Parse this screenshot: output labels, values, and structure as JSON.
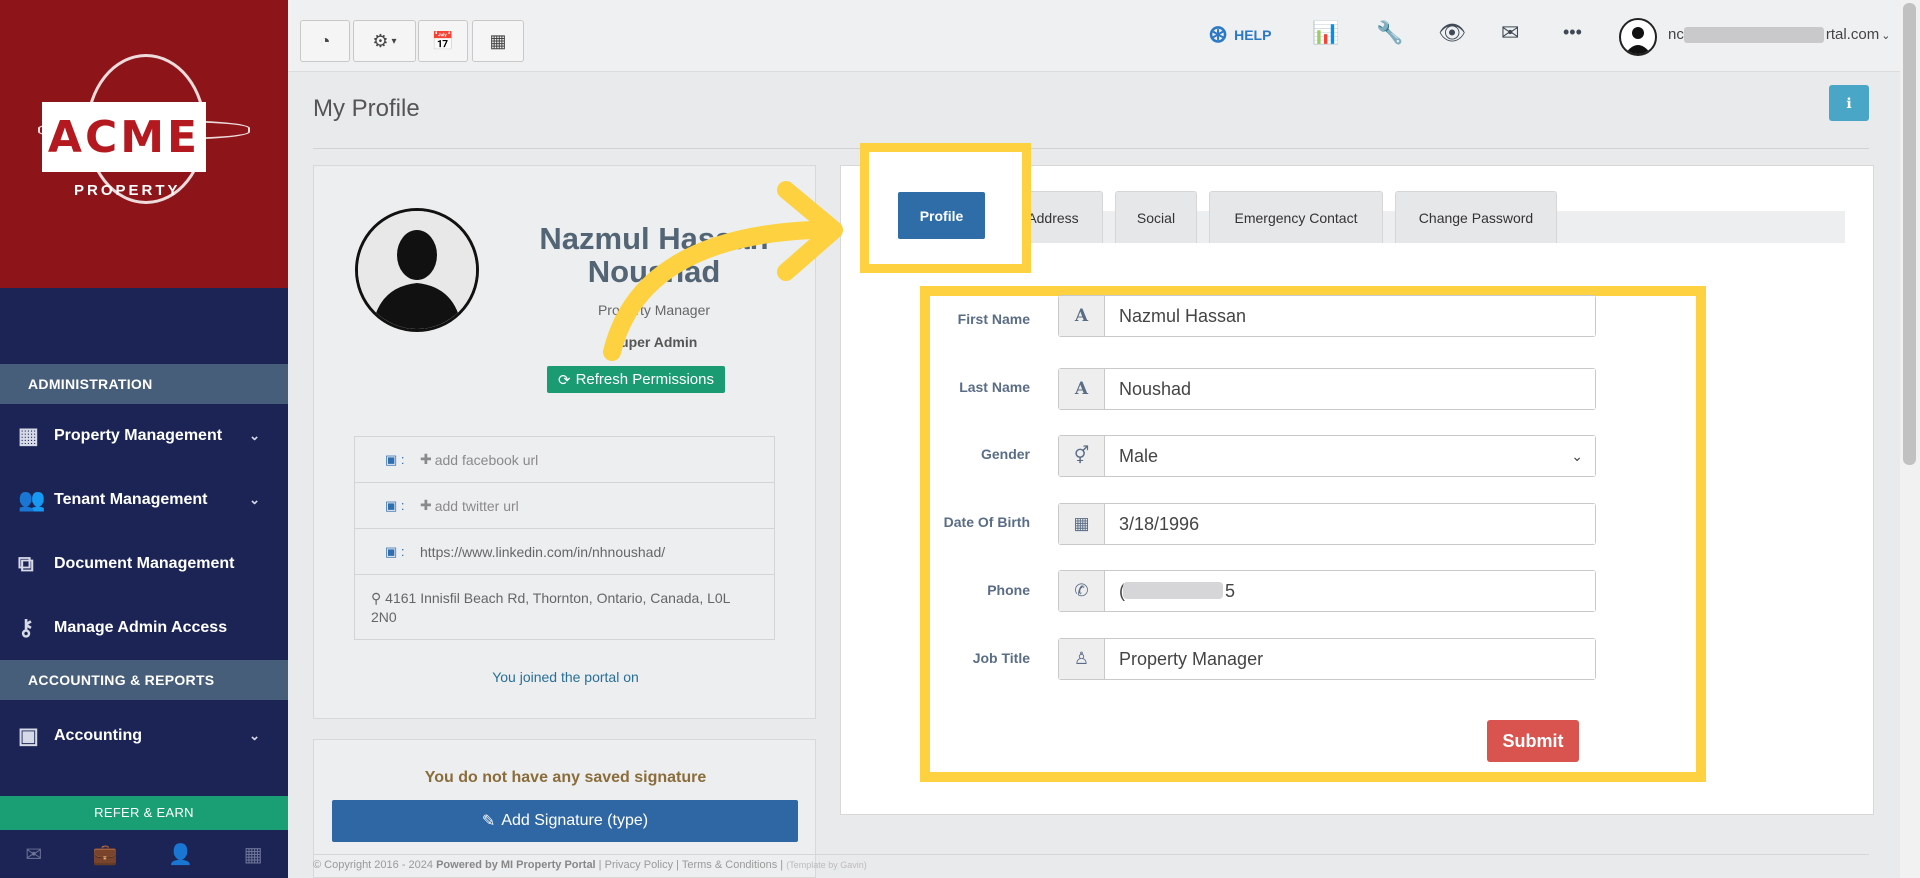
{
  "sidebar": {
    "logo_text": "ACME",
    "logo_sub": "PROPERTY",
    "section_admin": "ADMINISTRATION",
    "items_admin": [
      {
        "label": "Property Management",
        "icon": "building-icon",
        "chevron": true
      },
      {
        "label": "Tenant Management",
        "icon": "users-icon",
        "chevron": true
      },
      {
        "label": "Document Management",
        "icon": "documents-icon",
        "chevron": false
      },
      {
        "label": "Manage Admin Access",
        "icon": "key-icon",
        "chevron": false
      }
    ],
    "section_accounting": "ACCOUNTING & REPORTS",
    "items_accounting": [
      {
        "label": "Accounting",
        "icon": "money-icon",
        "chevron": true
      }
    ],
    "refer": "REFER & EARN"
  },
  "topbar": {
    "help": "HELP",
    "user_email_start": "nc",
    "user_email_end": "rtal.com"
  },
  "page": {
    "title": "My Profile"
  },
  "profile_card": {
    "name": "Nazmul Hassan Noushad",
    "role": "Property Manager",
    "access": "Super Admin",
    "refresh": "Refresh Permissions",
    "facebook": "add facebook url",
    "twitter": "add twitter url",
    "linkedin": "https://www.linkedin.com/in/nhnoushad/",
    "address": "4161 Innisfil Beach Rd, Thornton, Ontario, Canada, L0L 2N0",
    "joined": "You joined the portal on"
  },
  "signature": {
    "message": "You do not have any saved signature",
    "button": "Add Signature (type)"
  },
  "tabs": [
    "Profile",
    "Address",
    "Social",
    "Emergency Contact",
    "Change Password"
  ],
  "form": {
    "first_name_label": "First Name",
    "first_name": "Nazmul Hassan",
    "last_name_label": "Last Name",
    "last_name": "Noushad",
    "gender_label": "Gender",
    "gender": "Male",
    "dob_label": "Date Of Birth",
    "dob": "3/18/1996",
    "phone_label": "Phone",
    "phone_start": "(",
    "phone_end": "5",
    "job_title_label": "Job Title",
    "job_title": "Property Manager",
    "submit": "Submit"
  },
  "footer": {
    "copyright": "© Copyright 2016 - 2024",
    "powered": "Powered by MI Property Portal",
    "privacy": "Privacy Policy",
    "terms": "Terms & Conditions",
    "template": "(Template by Gavin)"
  },
  "colors": {
    "sidebar": "#1b2455",
    "logo_bg": "#8d1519",
    "primary": "#2e6da8",
    "success": "#1b9b72",
    "danger": "#d9534f",
    "highlight": "#fdd13f"
  }
}
